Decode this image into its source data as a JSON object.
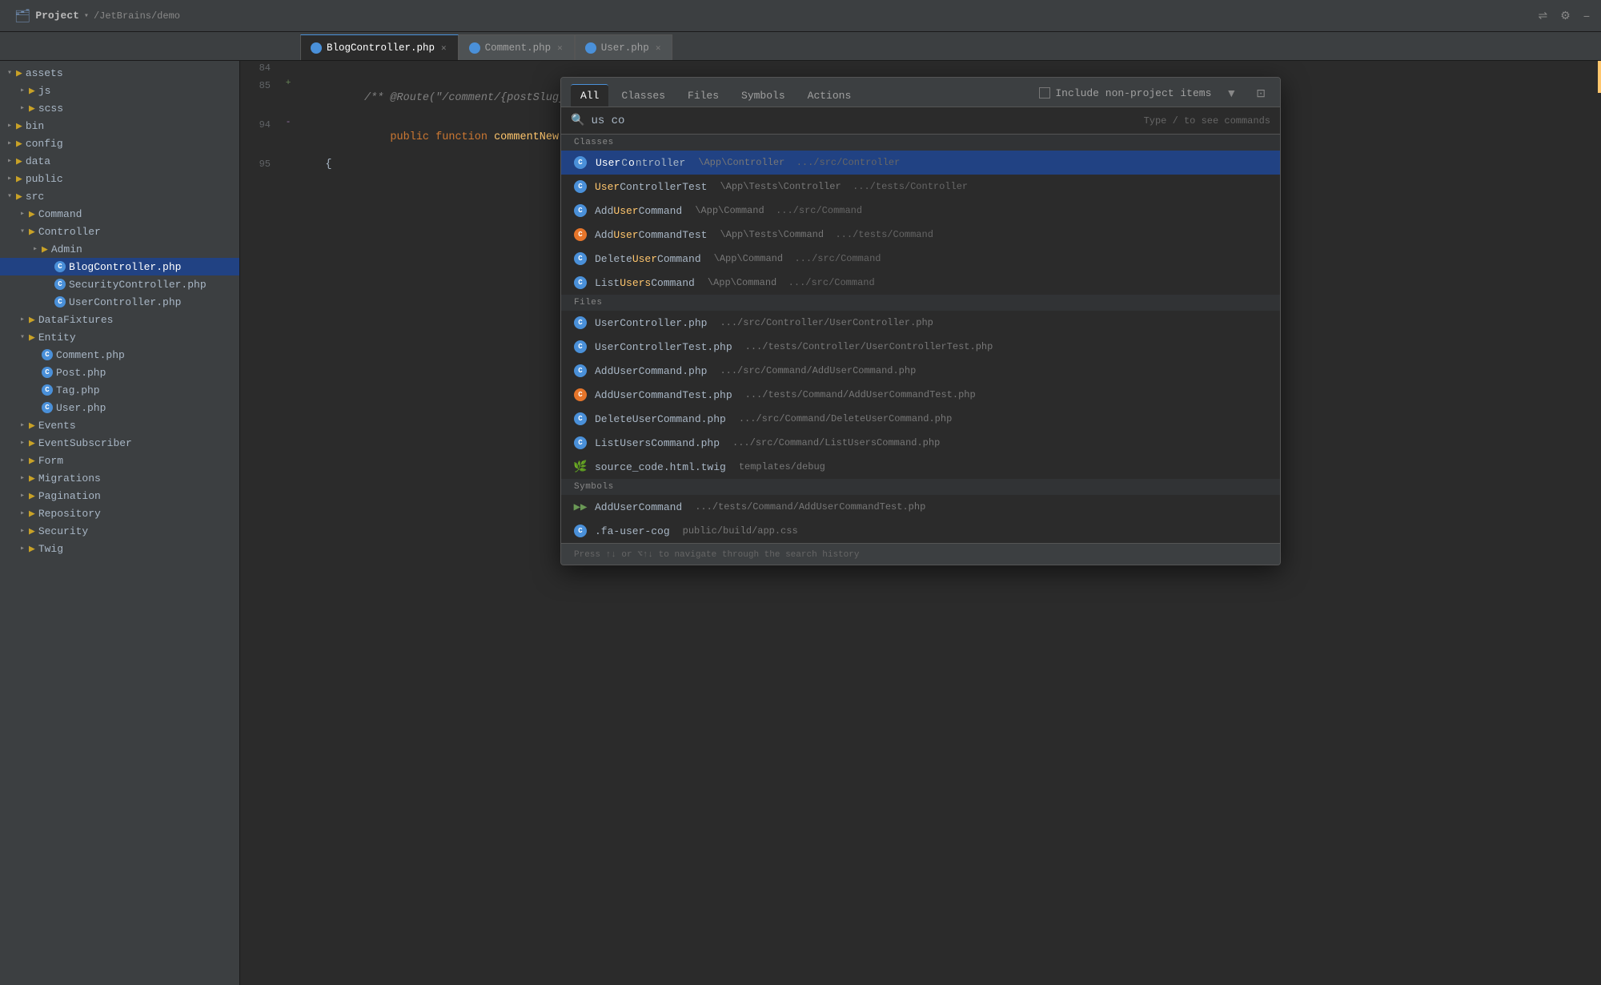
{
  "titleBar": {
    "projectLabel": "Project",
    "projectPath": "/JetBrains/demo",
    "rootFolder": "demo"
  },
  "tabs": [
    {
      "label": "BlogController.php",
      "active": true,
      "iconColor": "blue"
    },
    {
      "label": "Comment.php",
      "active": false,
      "iconColor": "blue"
    },
    {
      "label": "User.php",
      "active": false,
      "iconColor": "blue"
    }
  ],
  "sidebar": {
    "items": [
      {
        "label": "assets",
        "type": "folder",
        "depth": 0,
        "expanded": true
      },
      {
        "label": "js",
        "type": "folder",
        "depth": 1,
        "expanded": false
      },
      {
        "label": "scss",
        "type": "folder",
        "depth": 1,
        "expanded": false
      },
      {
        "label": "bin",
        "type": "folder",
        "depth": 0,
        "expanded": false
      },
      {
        "label": "config",
        "type": "folder",
        "depth": 0,
        "expanded": false
      },
      {
        "label": "data",
        "type": "folder",
        "depth": 0,
        "expanded": false
      },
      {
        "label": "public",
        "type": "folder",
        "depth": 0,
        "expanded": false
      },
      {
        "label": "src",
        "type": "folder",
        "depth": 0,
        "expanded": true
      },
      {
        "label": "Command",
        "type": "folder",
        "depth": 1,
        "expanded": false
      },
      {
        "label": "Controller",
        "type": "folder",
        "depth": 1,
        "expanded": true
      },
      {
        "label": "Admin",
        "type": "folder",
        "depth": 2,
        "expanded": false
      },
      {
        "label": "BlogController.php",
        "type": "file-blue",
        "depth": 3,
        "selected": true
      },
      {
        "label": "SecurityController.php",
        "type": "file-blue",
        "depth": 3
      },
      {
        "label": "UserController.php",
        "type": "file-blue",
        "depth": 3
      },
      {
        "label": "DataFixtures",
        "type": "folder",
        "depth": 1,
        "expanded": false
      },
      {
        "label": "Entity",
        "type": "folder",
        "depth": 1,
        "expanded": true
      },
      {
        "label": "Comment.php",
        "type": "file-blue",
        "depth": 2
      },
      {
        "label": "Post.php",
        "type": "file-blue",
        "depth": 2
      },
      {
        "label": "Tag.php",
        "type": "file-blue",
        "depth": 2
      },
      {
        "label": "User.php",
        "type": "file-blue",
        "depth": 2
      },
      {
        "label": "Events",
        "type": "folder",
        "depth": 1,
        "expanded": false
      },
      {
        "label": "EventSubscriber",
        "type": "folder",
        "depth": 1,
        "expanded": false
      },
      {
        "label": "Form",
        "type": "folder",
        "depth": 1,
        "expanded": false
      },
      {
        "label": "Migrations",
        "type": "folder",
        "depth": 1,
        "expanded": false
      },
      {
        "label": "Pagination",
        "type": "folder",
        "depth": 1,
        "expanded": false
      },
      {
        "label": "Repository",
        "type": "folder",
        "depth": 1,
        "expanded": false
      },
      {
        "label": "Security",
        "type": "folder",
        "depth": 1,
        "expanded": false
      },
      {
        "label": "Twig",
        "type": "folder",
        "depth": 1,
        "expanded": false
      }
    ]
  },
  "codeLines": [
    {
      "num": "84",
      "gutter": "",
      "content": ""
    },
    {
      "num": "85",
      "gutter": "+",
      "content": "    /** @Route(\"/comment/{postSlug}/new\", methods=\"POST\", name=\"comment_new\") ...*/"
    },
    {
      "num": "94",
      "gutter": "-",
      "content": "    public function commentNew(Request $request, Post $post, EventDispatcherInterfa"
    },
    {
      "num": "95",
      "gutter": "",
      "content": "    {"
    }
  ],
  "searchDialog": {
    "tabs": [
      "All",
      "Classes",
      "Files",
      "Symbols",
      "Actions"
    ],
    "activeTab": "All",
    "searchValue": "us co",
    "hint": "Type / to see commands",
    "checkbox": {
      "label": "Include non-project items",
      "checked": false
    },
    "sections": {
      "classes": {
        "header": "Classes",
        "items": [
          {
            "name": "UserController",
            "nameHighlight": [
              0,
              4,
              7,
              13
            ],
            "path": "\\App\\Controller",
            "pathShort": ".../src/Controller",
            "selected": true
          },
          {
            "name": "UserControllerTest",
            "nameHighlight": [
              0,
              4
            ],
            "path": "\\App\\Tests\\Controller",
            "pathShort": ".../tests/Controller",
            "selected": false
          },
          {
            "name": "AddUserCommand",
            "nameHighlight": [
              3,
              7
            ],
            "path": "\\App\\Command",
            "pathShort": ".../src/Command",
            "selected": false
          },
          {
            "name": "AddUserCommandTest",
            "nameHighlight": [
              3,
              7
            ],
            "path": "\\App\\Tests\\Command",
            "pathShort": ".../tests/Command",
            "selected": false
          },
          {
            "name": "DeleteUserCommand",
            "nameHighlight": [
              6,
              10
            ],
            "path": "\\App\\Command",
            "pathShort": ".../src/Command",
            "selected": false
          },
          {
            "name": "ListUsersCommand",
            "nameHighlight": [
              4,
              9
            ],
            "path": "\\App\\Command",
            "pathShort": ".../src/Command",
            "selected": false
          }
        ]
      },
      "files": {
        "header": "Files",
        "items": [
          {
            "name": "UserController.php",
            "path": ".../src/Controller/UserController.php"
          },
          {
            "name": "UserControllerTest.php",
            "path": ".../tests/Controller/UserControllerTest.php"
          },
          {
            "name": "AddUserCommand.php",
            "path": ".../src/Command/AddUserCommand.php"
          },
          {
            "name": "AddUserCommandTest.php",
            "path": ".../tests/Command/AddUserCommandTest.php"
          },
          {
            "name": "DeleteUserCommand.php",
            "path": ".../src/Command/DeleteUserCommand.php"
          },
          {
            "name": "ListUsersCommand.php",
            "path": ".../src/Command/ListUsersCommand.php"
          },
          {
            "name": "source_code.html.twig",
            "path": "templates/debug",
            "twig": true
          }
        ]
      },
      "symbols": {
        "header": "Symbols",
        "items": [
          {
            "name": "AddUserCommand",
            "path": ".../tests/Command/AddUserCommandTest.php",
            "arrow": true
          },
          {
            "name": ".fa-user-cog",
            "path": "public/build/app.css",
            "css": true
          }
        ]
      }
    },
    "footer": "Press ↑↓ or ⌥↑↓ to navigate through the search history"
  }
}
